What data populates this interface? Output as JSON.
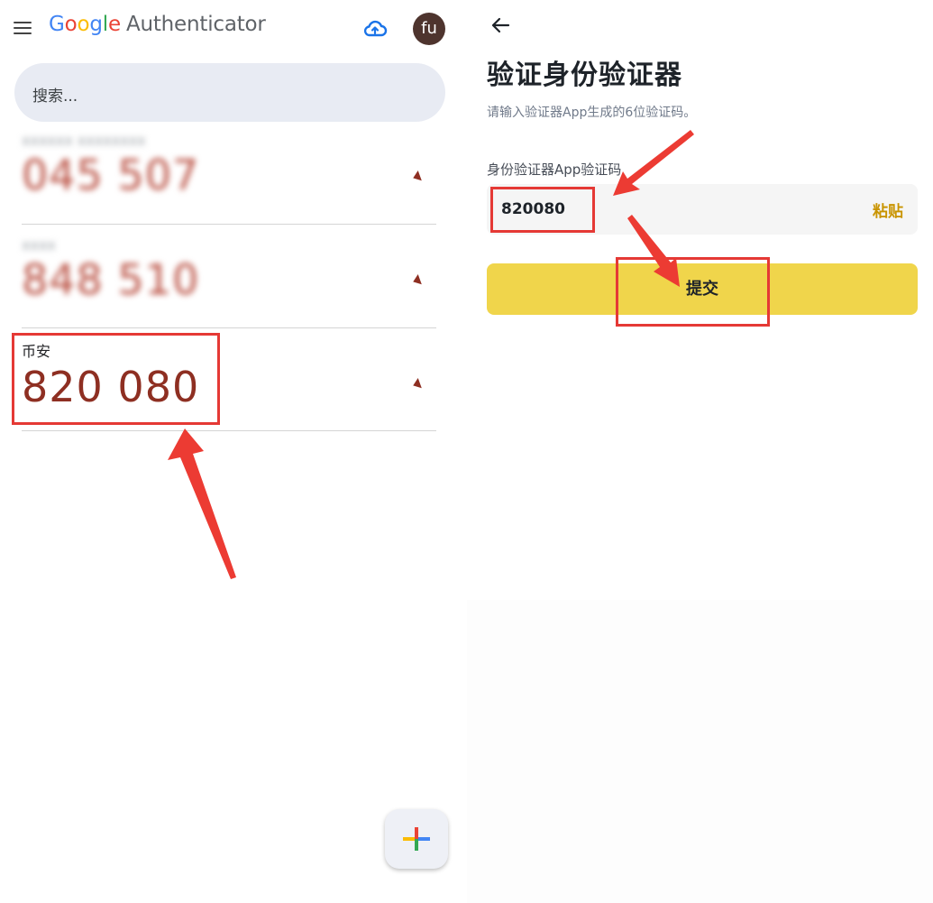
{
  "authenticator": {
    "logo_parts": [
      "G",
      "o",
      "o",
      "g",
      "l",
      "e"
    ],
    "app_name": "Authenticator",
    "avatar_initials": "fu",
    "search_placeholder": "搜索...",
    "items": [
      {
        "label": "xxxxxx xxxxxxxx",
        "code": "045 507",
        "obscured": true
      },
      {
        "label": "xxxx",
        "code": "848 510",
        "obscured": true
      },
      {
        "label": "币安",
        "code": "820 080",
        "obscured": false
      }
    ],
    "fab_label": "+"
  },
  "binance": {
    "title": "验证身份验证器",
    "subtitle": "请输入验证器App生成的6位验证码。",
    "field_label": "身份验证器App验证码",
    "code_value": "820080",
    "paste_label": "粘贴",
    "submit_label": "提交"
  },
  "colors": {
    "code_red": "#8e2f22",
    "annotation_red": "#e53935",
    "submit_yellow": "#f0d54b",
    "paste_gold": "#c99400"
  }
}
